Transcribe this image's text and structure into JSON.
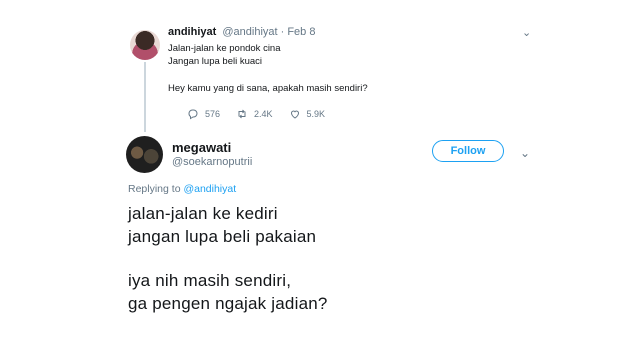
{
  "parent_tweet": {
    "name": "andihiyat",
    "handle_and_date": "@andihiyat · Feb 8",
    "lines": [
      "Jalan-jalan ke pondok cina",
      "Jangan lupa beli kuaci"
    ],
    "line3": "Hey kamu yang di sana, apakah masih sendiri?",
    "replies": "576",
    "retweets": "2.4K",
    "likes": "5.9K",
    "chevron_icon": "chevron-down-icon"
  },
  "reply_tweet": {
    "name": "megawati",
    "handle": "@soekarnoputrii",
    "follow_label": "Follow",
    "replying_prefix": "Replying to",
    "replying_mention": "@andihiyat",
    "body_lines": [
      "jalan-jalan ke kediri",
      "jangan lupa beli pakaian",
      "iya nih masih sendiri,",
      "ga pengen ngajak jadian?"
    ]
  },
  "colors": {
    "accent": "#1da1f2",
    "muted": "#657786",
    "text": "#14171a",
    "thread_line": "#ccd6dd"
  }
}
